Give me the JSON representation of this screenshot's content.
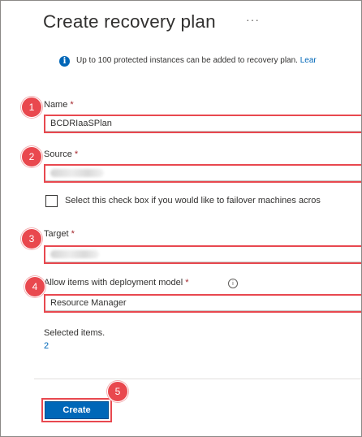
{
  "panel": {
    "title": "Create recovery plan",
    "more_label": "···"
  },
  "info": {
    "icon": "info-icon",
    "text": "Up to 100 protected instances can be added to recovery plan.",
    "link": "Lear"
  },
  "fields": {
    "name": {
      "label": "Name",
      "required": "*",
      "value": "BCDRIaaSPlan"
    },
    "source": {
      "label": "Source",
      "required": "*"
    },
    "target": {
      "label": "Target",
      "required": "*"
    },
    "deployment_model": {
      "label": "Allow items with deployment model",
      "required": "*",
      "value": "Resource Manager",
      "help_icon": "question-icon"
    }
  },
  "failover_checkbox": {
    "checked": false,
    "label": "Select this check box if you would like to failover machines acros"
  },
  "selected_items": {
    "label": "Selected items.",
    "count": "2"
  },
  "footer": {
    "create_label": "Create"
  },
  "callouts": [
    "1",
    "2",
    "3",
    "4",
    "5"
  ],
  "colors": {
    "accent": "#0067b8",
    "highlight": "#e8484f",
    "callout": "#e9484e",
    "required": "#a4262c"
  }
}
